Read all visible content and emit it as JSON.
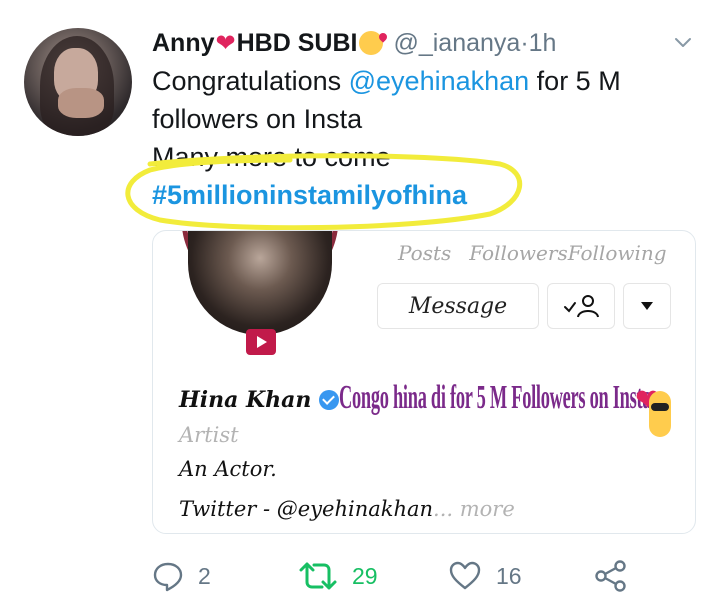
{
  "tweet": {
    "display_name": "Anny",
    "display_name_heart": "❤",
    "display_name_suffix": "HBD SUBI",
    "handle": "@_iananya",
    "separator": " · ",
    "time": "1h",
    "text_line1_prefix": "Congratulations ",
    "mention": "@eyehinakhan",
    "text_line1_suffix": " for 5 M",
    "text_line2": "followers on Insta",
    "text_line3": "Many more to come",
    "hashtag": "#5millioninstamilyofhina",
    "highlight_color": "#f2ec3b"
  },
  "card": {
    "stats": [
      "Posts",
      "Followers",
      "Following"
    ],
    "message_button": "Message",
    "profile_name": "Hina Khan",
    "overlay_text": "Congo hina di for 5 M Followers on Insta",
    "category": "Artist",
    "bio_line1": "An Actor.",
    "bio_line2": "Twitter - @eyehinakhan",
    "bio_more": "... more",
    "ring_color": "#8a2a3d",
    "play_color": "#c11a4a"
  },
  "actions": {
    "reply_count": "2",
    "retweet_count": "29",
    "like_count": "16"
  },
  "colors": {
    "link": "#1b95e0",
    "muted": "#657786",
    "retweet": "#17bf63",
    "heart": "#e0245e"
  },
  "icons": [
    "chevron-down-icon",
    "reply-icon",
    "retweet-icon",
    "like-icon",
    "share-icon",
    "verified-badge-icon",
    "play-icon",
    "add-friend-icon",
    "dropdown-arrow-icon"
  ]
}
